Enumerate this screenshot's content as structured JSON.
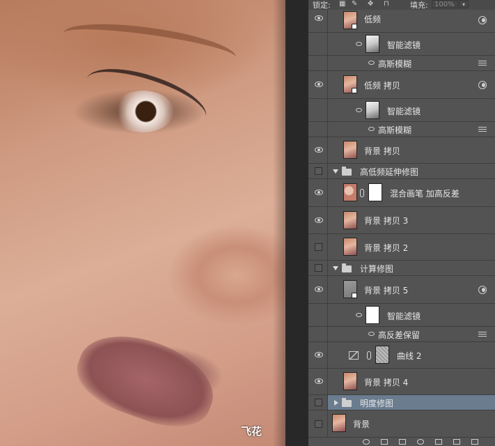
{
  "canvas": {
    "watermark": "飞花"
  },
  "lockbar": {
    "lock_label": "锁定:",
    "lock_icons": [
      "lock-transparent-pixels-icon",
      "lock-image-pixels-icon",
      "lock-position-icon",
      "lock-all-icon"
    ],
    "fill_label": "填充:",
    "fill_value": "100%"
  },
  "layers": [
    {
      "name": "低频",
      "visible": true
    },
    {
      "name": "智能滤镜",
      "visible": true
    },
    {
      "name": "高斯模糊",
      "visible": true
    },
    {
      "name": "低频 拷贝",
      "visible": true
    },
    {
      "name": "智能滤镜",
      "visible": true
    },
    {
      "name": "高斯模糊",
      "visible": true
    },
    {
      "name": "背景 拷贝",
      "visible": true
    },
    {
      "name": "高低频延伸修图",
      "visible": false
    },
    {
      "name": "混合画笔 加高反差",
      "visible": true
    },
    {
      "name": "背景 拷贝 3",
      "visible": true
    },
    {
      "name": "背景 拷贝 2",
      "visible": false
    },
    {
      "name": "计算修图",
      "visible": false
    },
    {
      "name": "背景 拷贝 5",
      "visible": true
    },
    {
      "name": "智能滤镜",
      "visible": true
    },
    {
      "name": "高反差保留",
      "visible": true
    },
    {
      "name": "曲线 2",
      "visible": true
    },
    {
      "name": "背景 拷贝 4",
      "visible": true
    },
    {
      "name": "明度修图",
      "visible": false
    },
    {
      "name": "背景",
      "visible": false
    }
  ],
  "colors": {
    "panel_bg": "#535353",
    "selected_row": "#6b7c8f",
    "canvas_surround": "#282828"
  }
}
